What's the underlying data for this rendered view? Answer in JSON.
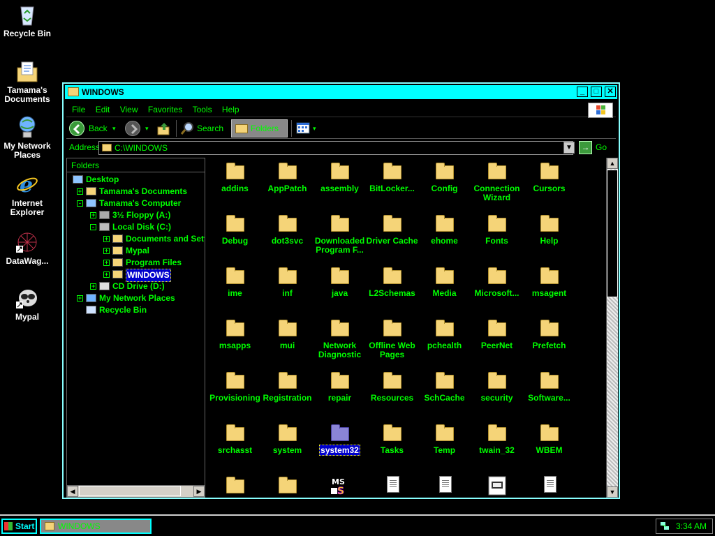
{
  "desktop": {
    "icons": [
      {
        "label": "Recycle Bin",
        "icon": "recycle-bin-icon"
      },
      {
        "label": "Tamama's Documents",
        "icon": "my-documents-icon"
      },
      {
        "label": "My Network Places",
        "icon": "network-places-icon"
      },
      {
        "label": "Internet Explorer",
        "icon": "internet-explorer-icon"
      },
      {
        "label": "DataWag...",
        "icon": "datawag-shortcut-icon"
      },
      {
        "label": "Mypal",
        "icon": "mypal-shortcut-icon"
      }
    ]
  },
  "window": {
    "title": "WINDOWS",
    "menu": [
      "File",
      "Edit",
      "View",
      "Favorites",
      "Tools",
      "Help"
    ],
    "toolbar": {
      "back": "Back",
      "search": "Search",
      "folders": "Folders"
    },
    "address": {
      "label": "Address",
      "value": "C:\\WINDOWS",
      "go": "Go"
    },
    "folders_pane": {
      "header": "Folders",
      "tree": [
        {
          "label": "Desktop",
          "depth": 0,
          "expander": ""
        },
        {
          "label": "Tamama's Documents",
          "depth": 1,
          "expander": "+"
        },
        {
          "label": "Tamama's Computer",
          "depth": 1,
          "expander": "-"
        },
        {
          "label": "3½ Floppy (A:)",
          "depth": 2,
          "expander": "+"
        },
        {
          "label": "Local Disk (C:)",
          "depth": 2,
          "expander": "-"
        },
        {
          "label": "Documents and Sett",
          "depth": 3,
          "expander": "+"
        },
        {
          "label": "Mypal",
          "depth": 3,
          "expander": "+"
        },
        {
          "label": "Program Files",
          "depth": 3,
          "expander": "+"
        },
        {
          "label": "WINDOWS",
          "depth": 3,
          "expander": "+",
          "selected": true
        },
        {
          "label": "CD Drive (D:)",
          "depth": 2,
          "expander": "+"
        },
        {
          "label": "My Network Places",
          "depth": 1,
          "expander": "+"
        },
        {
          "label": "Recycle Bin",
          "depth": 1,
          "expander": ""
        }
      ]
    },
    "files": [
      {
        "name": "addins",
        "type": "folder"
      },
      {
        "name": "AppPatch",
        "type": "folder"
      },
      {
        "name": "assembly",
        "type": "folder"
      },
      {
        "name": "BitLocker...",
        "type": "folder"
      },
      {
        "name": "Config",
        "type": "folder"
      },
      {
        "name": "Connection Wizard",
        "type": "folder"
      },
      {
        "name": "Cursors",
        "type": "folder"
      },
      {
        "name": "Debug",
        "type": "folder"
      },
      {
        "name": "dot3svc",
        "type": "folder"
      },
      {
        "name": "Downloaded Program F...",
        "type": "folder"
      },
      {
        "name": "Driver Cache",
        "type": "folder"
      },
      {
        "name": "ehome",
        "type": "folder"
      },
      {
        "name": "Fonts",
        "type": "folder"
      },
      {
        "name": "Help",
        "type": "folder"
      },
      {
        "name": "ime",
        "type": "folder"
      },
      {
        "name": "inf",
        "type": "folder"
      },
      {
        "name": "java",
        "type": "folder"
      },
      {
        "name": "L2Schemas",
        "type": "folder"
      },
      {
        "name": "Media",
        "type": "folder"
      },
      {
        "name": "Microsoft...",
        "type": "folder"
      },
      {
        "name": "msagent",
        "type": "folder"
      },
      {
        "name": "msapps",
        "type": "folder"
      },
      {
        "name": "mui",
        "type": "folder"
      },
      {
        "name": "Network Diagnostic",
        "type": "folder"
      },
      {
        "name": "Offline Web Pages",
        "type": "folder"
      },
      {
        "name": "pchealth",
        "type": "folder"
      },
      {
        "name": "PeerNet",
        "type": "folder"
      },
      {
        "name": "Prefetch",
        "type": "folder"
      },
      {
        "name": "Provisioning",
        "type": "folder"
      },
      {
        "name": "Registration",
        "type": "folder"
      },
      {
        "name": "repair",
        "type": "folder"
      },
      {
        "name": "Resources",
        "type": "folder"
      },
      {
        "name": "SchCache",
        "type": "folder"
      },
      {
        "name": "security",
        "type": "folder"
      },
      {
        "name": "Software...",
        "type": "folder"
      },
      {
        "name": "srchasst",
        "type": "folder"
      },
      {
        "name": "system",
        "type": "folder"
      },
      {
        "name": "system32",
        "type": "folder-selected"
      },
      {
        "name": "Tasks",
        "type": "folder"
      },
      {
        "name": "Temp",
        "type": "folder"
      },
      {
        "name": "twain_32",
        "type": "folder"
      },
      {
        "name": "WBEM",
        "type": "folder"
      },
      {
        "name": "",
        "type": "folder"
      },
      {
        "name": "",
        "type": "folder"
      },
      {
        "name": "",
        "type": "ms-dos-app"
      },
      {
        "name": "",
        "type": "document"
      },
      {
        "name": "",
        "type": "document"
      },
      {
        "name": "",
        "type": "image-document"
      },
      {
        "name": "",
        "type": "document"
      }
    ]
  },
  "taskbar": {
    "start": "Start",
    "task_label": "WINDOWS",
    "clock": "3:34 AM"
  }
}
